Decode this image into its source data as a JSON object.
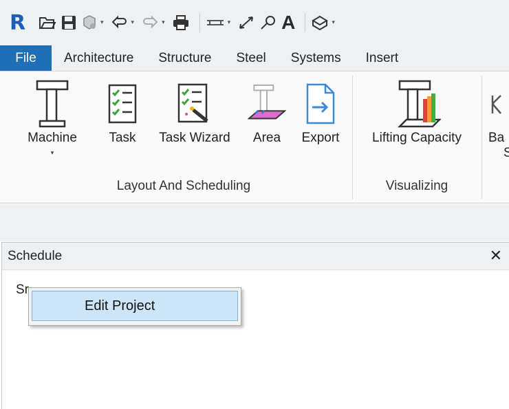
{
  "qat": {
    "logo": "R",
    "text_tool": "A"
  },
  "tabs": [
    {
      "label": "File"
    },
    {
      "label": "Architecture"
    },
    {
      "label": "Structure"
    },
    {
      "label": "Steel"
    },
    {
      "label": "Systems"
    },
    {
      "label": "Insert"
    }
  ],
  "ribbon": {
    "buttons": [
      {
        "label": "Machine",
        "dropdown": "▾"
      },
      {
        "label": "Task"
      },
      {
        "label": "Task Wizard"
      },
      {
        "label": "Area"
      },
      {
        "label": "Export"
      },
      {
        "label": "Lifting Capacity"
      },
      {
        "label": "Ba",
        "label2": "S"
      }
    ],
    "panels": [
      {
        "title": "Layout And Scheduling"
      },
      {
        "title": "Visualizing"
      }
    ]
  },
  "schedule": {
    "title": "Schedule",
    "close": "✕",
    "item_partial": "Sr"
  },
  "context_menu": {
    "items": [
      {
        "label": "Edit Project"
      }
    ]
  }
}
